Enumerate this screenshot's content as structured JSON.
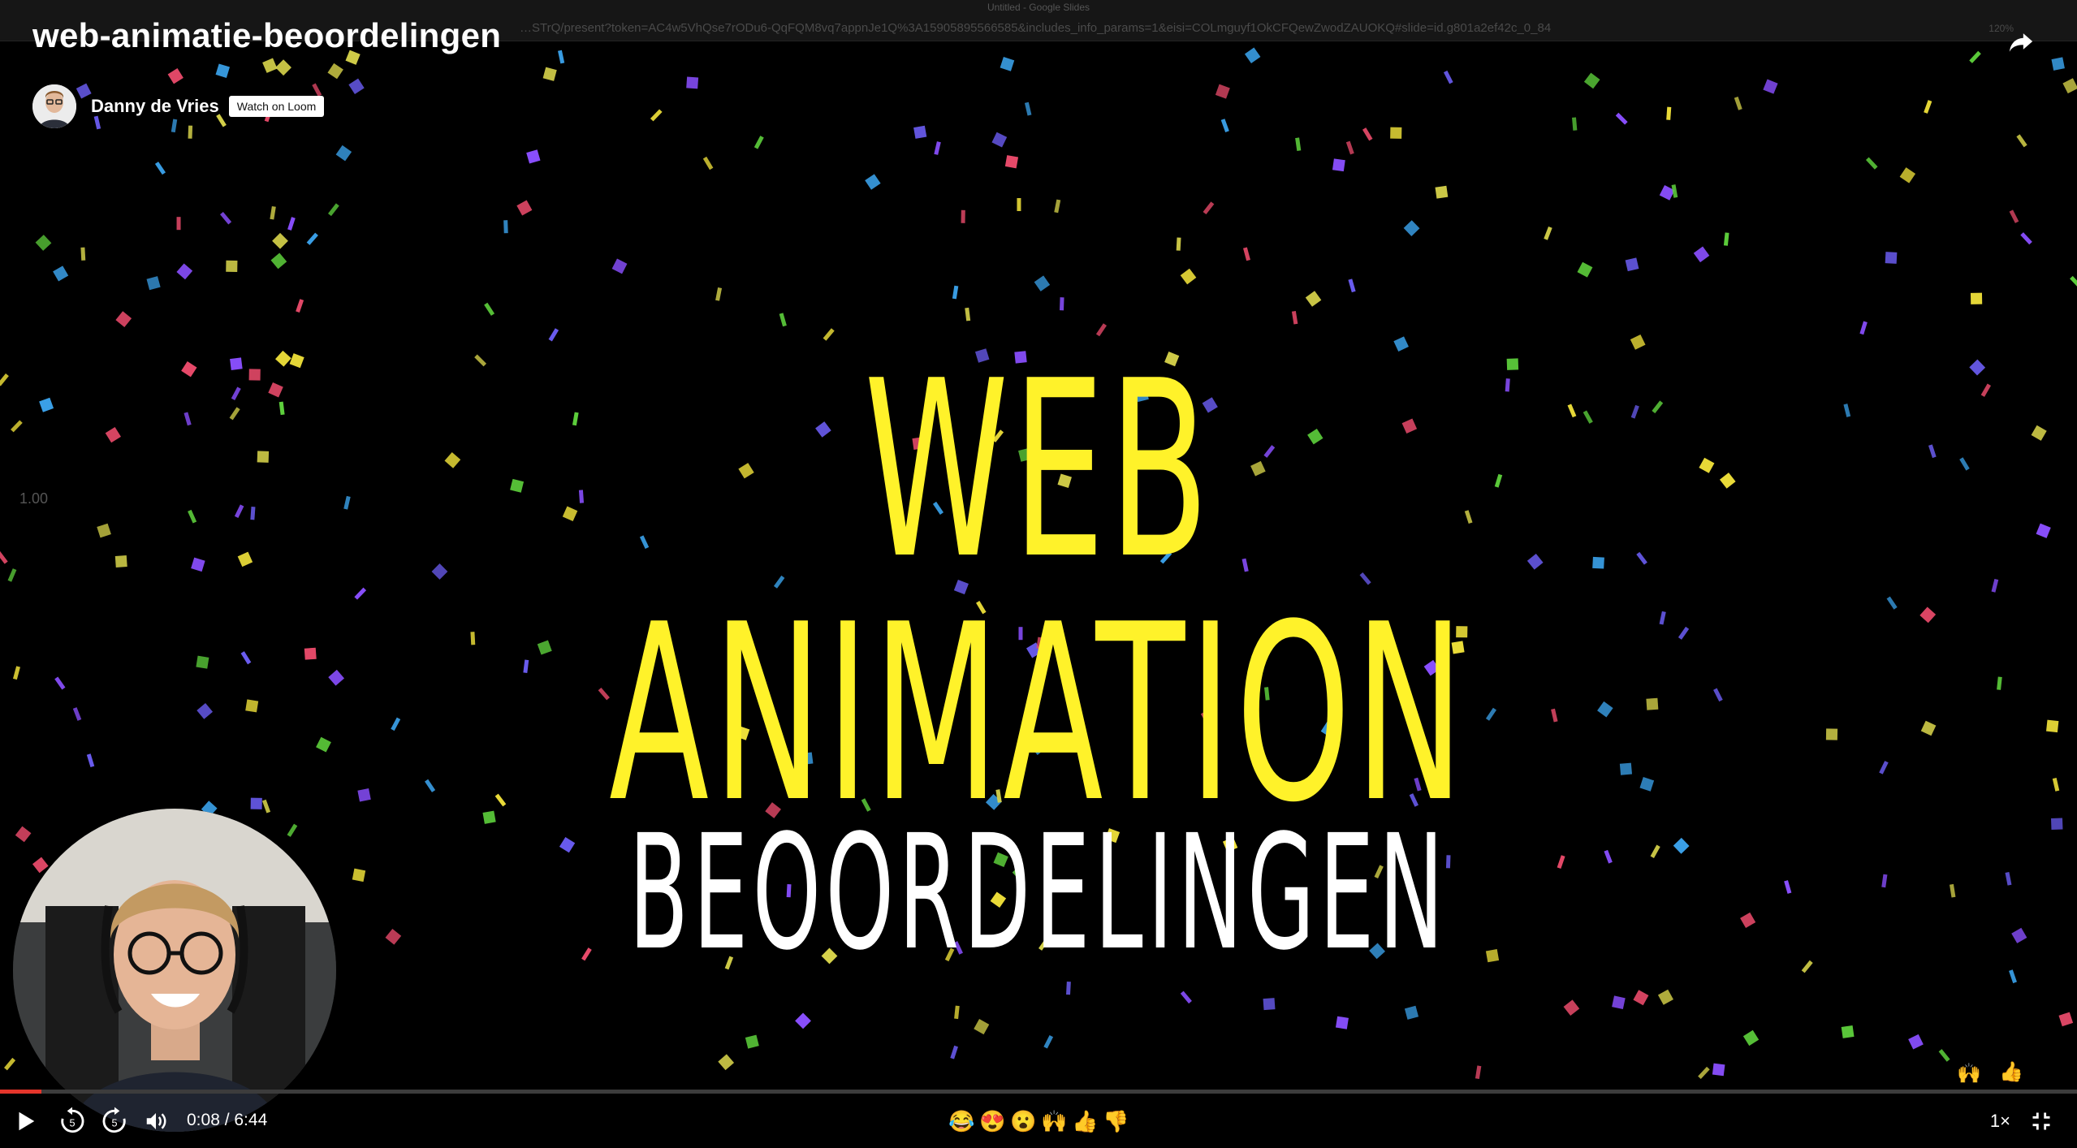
{
  "browser": {
    "tab_title": "Untitled - Google Slides",
    "url": "…STrQ/present?token=AC4w5VhQse7rODu6-QqFQM8vq7appnJe1Q%3A15905895566585&includes_info_params=1&eisi=COLmguyf1OkCFQewZwodZAUOKQ#slide=id.g801a2ef42c_0_84",
    "zoom": "120%"
  },
  "video": {
    "title": "web-animatie-beoordelingen",
    "author": "Danny de Vries",
    "watch_label": "Watch on Loom"
  },
  "slide": {
    "title": "WEB ANIMATION",
    "subtitle": "BEOORDELINGEN",
    "side_label": "1.00"
  },
  "player": {
    "current_time": "0:08",
    "duration": "6:44",
    "time_display": "0:08 / 6:44",
    "progress": 0.02,
    "skip_back_seconds": "5",
    "skip_forward_seconds": "5",
    "speed": "1×",
    "reactions": [
      "😂",
      "😍",
      "😮",
      "🙌",
      "👍",
      "👎"
    ],
    "floating_reactions": [
      "🙌",
      "👍"
    ]
  },
  "colors": {
    "title_yellow": "#fff22a",
    "progress_red": "#e4352b",
    "background": "#000000"
  },
  "icons": {
    "share": "share-arrow-icon",
    "play": "play-icon",
    "rewind": "rewind-5-icon",
    "forward": "forward-5-icon",
    "volume": "volume-icon",
    "fullscreen": "exit-fullscreen-icon"
  }
}
